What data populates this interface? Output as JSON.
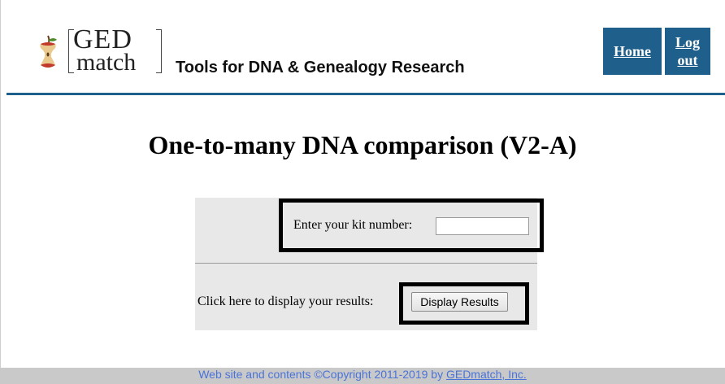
{
  "header": {
    "logo": {
      "line1": "GED",
      "line2": "match",
      "icon": "apple-core-icon"
    },
    "tagline": "Tools for DNA & Genealogy Research",
    "nav": {
      "home": "Home",
      "logout_line1": "Log",
      "logout_line2": "out"
    },
    "accent_color": "#1f5f8b"
  },
  "page": {
    "title": "One-to-many DNA comparison (V2-A)"
  },
  "form": {
    "kit_label": "Enter your kit number:",
    "kit_value": "",
    "results_label": "Click here to display your results:",
    "display_button": "Display Results"
  },
  "footer": {
    "text": "Web site and contents ©Copyright 2011-2019 by ",
    "link": "GEDmatch, Inc."
  }
}
